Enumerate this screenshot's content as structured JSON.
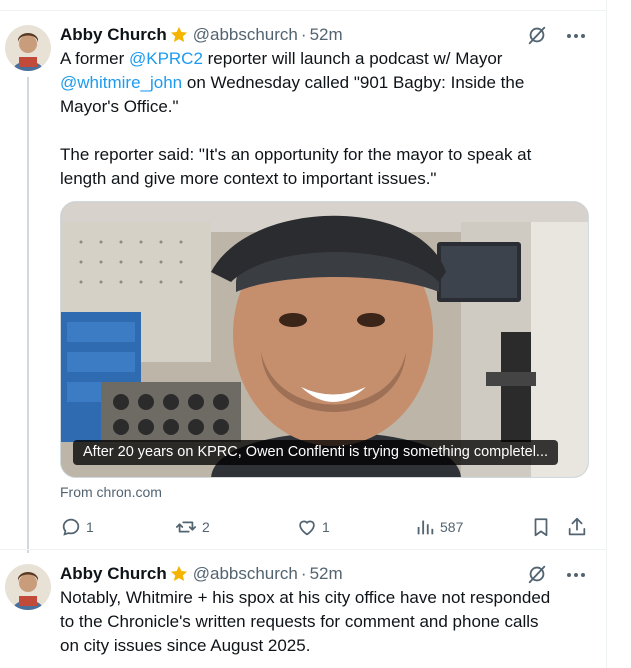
{
  "tweets": [
    {
      "author_name": "Abby Church",
      "handle": "@abbschurch",
      "separator": "·",
      "time": "52m",
      "text_parts": [
        {
          "t": "A former ",
          "type": "text"
        },
        {
          "t": "@KPRC2",
          "type": "mention"
        },
        {
          "t": " reporter will launch a podcast w/ Mayor\n",
          "type": "text"
        },
        {
          "t": "@whitmire_john",
          "type": "mention"
        },
        {
          "t": " on Wednesday called \"901 Bagby: Inside the\nMayor's Office.\"\n\nThe reporter said: \"It's an opportunity for the mayor to speak at\nlength and give more context to important issues.\"",
          "type": "text"
        }
      ],
      "card": {
        "caption": "After 20 years on KPRC, Owen Conflenti is trying something completel...",
        "source": "From chron.com"
      },
      "actions": {
        "replies": "1",
        "reposts": "2",
        "likes": "1",
        "views": "587"
      }
    },
    {
      "author_name": "Abby Church",
      "handle": "@abbschurch",
      "separator": "·",
      "time": "52m",
      "text": "Notably, Whitmire + his spox at his city office have not responded\nto the Chronicle's written requests for comment and phone calls\non city issues since August 2025."
    }
  ],
  "icons": {
    "verified_badge": "star-badge-icon",
    "grok": "grok-icon",
    "more": "more-icon",
    "reply": "reply-icon",
    "repost": "repost-icon",
    "like": "like-icon",
    "views": "views-icon",
    "bookmark": "bookmark-icon",
    "share": "share-icon"
  },
  "colors": {
    "text": "#0f1419",
    "secondary": "#536471",
    "link": "#1d9bf0",
    "badge": "#f4b400",
    "border": "#cfd9de"
  }
}
